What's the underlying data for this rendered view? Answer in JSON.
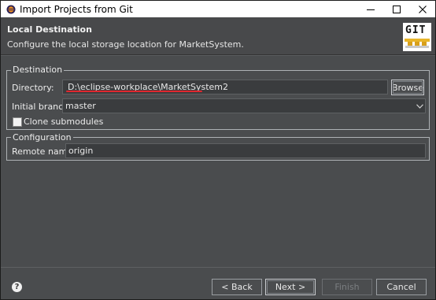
{
  "window": {
    "title": "Import Projects from Git",
    "icons": {
      "app": "eclipse-icon",
      "minimize": "minimize-icon",
      "maximize": "maximize-icon",
      "close": "close-icon"
    }
  },
  "header": {
    "title": "Local Destination",
    "description": "Configure the local storage location for MarketSystem.",
    "logo_text": "GIT"
  },
  "destination": {
    "group_label": "Destination",
    "directory_label": "Directory:",
    "directory_value": "D:\\eclipse-workplace\\MarketSystem2",
    "browse_label": "Browse",
    "branch_label": "Initial branch:",
    "branch_value": "master",
    "clone_submodules_label": "Clone submodules",
    "clone_submodules_checked": false
  },
  "configuration": {
    "group_label": "Configuration",
    "remote_name_label": "Remote name:",
    "remote_name_value": "origin"
  },
  "footer": {
    "help_icon": "help-icon",
    "back_label": "< Back",
    "next_label": "Next >",
    "finish_label": "Finish",
    "cancel_label": "Cancel"
  },
  "colors": {
    "annotation_underline": "#e0282f"
  }
}
